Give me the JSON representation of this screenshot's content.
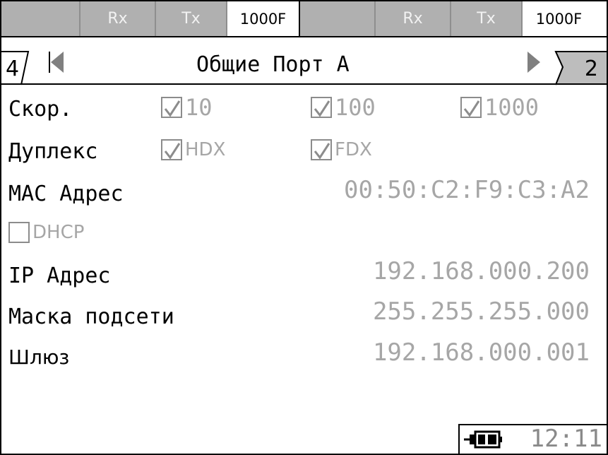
{
  "status_bar": {
    "port_a": {
      "rx": "Rx",
      "tx": "Tx",
      "mode": "1000F"
    },
    "port_b": {
      "rx": "Rx",
      "tx": "Tx",
      "mode": "1000F"
    }
  },
  "nav": {
    "prev_tab": "4",
    "title": "Общие Порт А",
    "next_tab": "2"
  },
  "speed": {
    "label": "Скор.",
    "options": [
      {
        "label": "10",
        "checked": true
      },
      {
        "label": "100",
        "checked": true
      },
      {
        "label": "1000",
        "checked": true
      }
    ]
  },
  "duplex": {
    "label": "Дуплекс",
    "options": [
      {
        "label": "HDX",
        "checked": true
      },
      {
        "label": "FDX",
        "checked": true
      }
    ]
  },
  "mac": {
    "label": "МАС Адрес",
    "value": "00:50:C2:F9:C3:A2"
  },
  "dhcp": {
    "label": "DHCP",
    "checked": false
  },
  "ip": {
    "label": "IP Адрес",
    "value": "192.168.000.200"
  },
  "mask": {
    "label": "Маска подсети",
    "value": "255.255.255.000"
  },
  "gateway": {
    "label": "Шлюз",
    "value": "192.168.000.001"
  },
  "clock": {
    "time": "12:11",
    "icon": "power-plug-icon"
  },
  "colors": {
    "inactive_cell": "#b0b0b0",
    "value_text": "#a6a6a6",
    "checkbox_border": "#8c8c8c"
  }
}
